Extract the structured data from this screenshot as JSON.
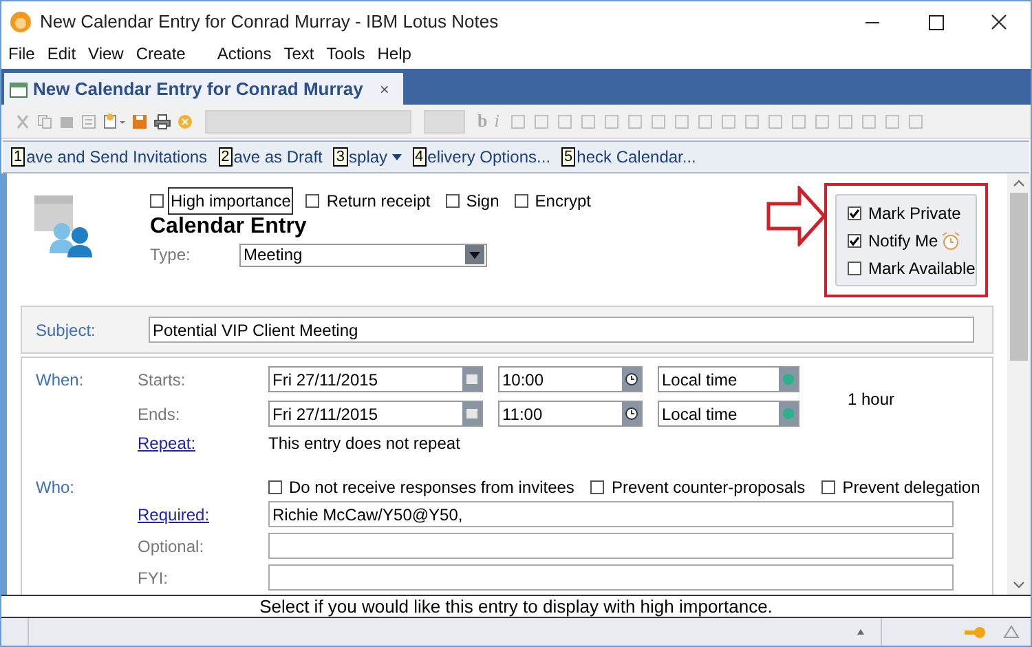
{
  "window": {
    "title": "New Calendar Entry for Conrad Murray - IBM Lotus Notes"
  },
  "menu": [
    {
      "label": "File"
    },
    {
      "label": "Edit"
    },
    {
      "label": "View"
    },
    {
      "label": "Create"
    },
    {
      "label": "Actions"
    },
    {
      "label": "Text"
    },
    {
      "label": "Tools"
    },
    {
      "label": "Help"
    }
  ],
  "tabs": [
    {
      "label": "New Calendar Entry for Conrad Murray",
      "close": "×",
      "selected": true
    }
  ],
  "toolbar": {
    "format_letters": [
      "b",
      "i"
    ]
  },
  "actions": [
    {
      "key": "1",
      "label": "ave and Send Invitations",
      "dropdown": false
    },
    {
      "key": "2",
      "label": "ave as Draft",
      "dropdown": false
    },
    {
      "key": "3",
      "label": "splay",
      "dropdown": true
    },
    {
      "key": "4",
      "label": "elivery Options...",
      "dropdown": false
    },
    {
      "key": "5",
      "label": "heck Calendar...",
      "dropdown": false
    }
  ],
  "header": {
    "options": [
      {
        "label": "High importance",
        "checked": false,
        "focused": true
      },
      {
        "label": "Return receipt",
        "checked": false,
        "focused": false
      },
      {
        "label": "Sign",
        "checked": false,
        "focused": false
      },
      {
        "label": "Encrypt",
        "checked": false,
        "focused": false
      }
    ],
    "title": "Calendar Entry",
    "type_label": "Type:",
    "type_value": "Meeting"
  },
  "privacy": [
    {
      "label": "Mark Private",
      "checked": true
    },
    {
      "label": "Notify Me",
      "checked": true,
      "alarm": true
    },
    {
      "label": "Mark Available",
      "checked": false
    }
  ],
  "subject": {
    "label": "Subject:",
    "value": "Potential VIP Client Meeting"
  },
  "when": {
    "label": "When:",
    "rows": [
      {
        "label": "Starts:",
        "date": "Fri 27/11/2015",
        "time": "10:00",
        "zone": "Local time"
      },
      {
        "label": "Ends:",
        "date": "Fri 27/11/2015",
        "time": "11:00",
        "zone": "Local time"
      }
    ],
    "duration": "1 hour",
    "repeat_label": "Repeat:",
    "repeat_text": "This entry does not repeat"
  },
  "who": {
    "label": "Who:",
    "options": [
      {
        "label": "Do not receive responses from invitees",
        "checked": false
      },
      {
        "label": "Prevent counter-proposals",
        "checked": false
      },
      {
        "label": "Prevent delegation",
        "checked": false
      }
    ],
    "fields": [
      {
        "label": "Required:",
        "link": true,
        "value": "Richie McCaw/Y50@Y50,"
      },
      {
        "label": "Optional:",
        "link": false
      },
      {
        "label": "FYI:",
        "link": false
      }
    ]
  },
  "status_message": "Select if you would like this entry to display with high importance."
}
